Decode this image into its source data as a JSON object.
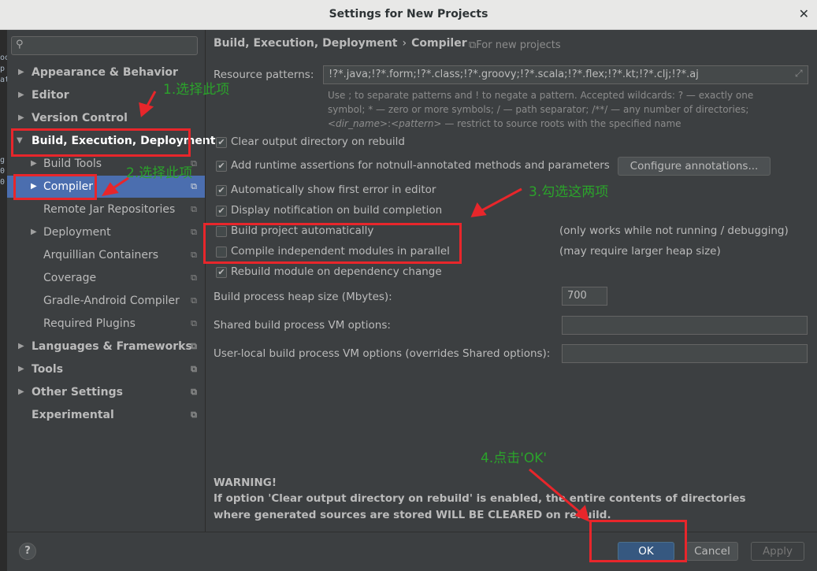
{
  "window": {
    "title": "Settings for New Projects"
  },
  "search": {
    "placeholder": ""
  },
  "tree": {
    "appearance": "Appearance & Behavior",
    "editor": "Editor",
    "version_control": "Version Control",
    "build": "Build, Execution, Deployment",
    "build_tools": "Build Tools",
    "compiler": "Compiler",
    "remote_jar": "Remote Jar Repositories",
    "deployment": "Deployment",
    "arquillian": "Arquillian Containers",
    "coverage": "Coverage",
    "gradle_android": "Gradle-Android Compiler",
    "required_plugins": "Required Plugins",
    "languages": "Languages & Frameworks",
    "tools": "Tools",
    "other_settings": "Other Settings",
    "experimental": "Experimental"
  },
  "breadcrumb": {
    "parent": "Build, Execution, Deployment",
    "separator": "›",
    "current": "Compiler",
    "scope": "⧉For new projects"
  },
  "compiler": {
    "resource_patterns_label": "Resource patterns:",
    "resource_patterns_value": "!?*.java;!?*.form;!?*.class;!?*.groovy;!?*.scala;!?*.flex;!?*.kt;!?*.clj;!?*.aj",
    "hint_line1": "Use ; to separate patterns and ! to negate a pattern. Accepted wildcards: ? — exactly one",
    "hint_line2": "symbol; * — zero or more symbols; / — path separator; /**/ — any number of directories;",
    "hint_line3_a": "<dir_name>",
    "hint_line3_b": ":",
    "hint_line3_c": "<pattern>",
    "hint_line3_d": " — restrict to source roots with the specified name",
    "clear_output": "Clear output directory on rebuild",
    "add_assertions": "Add runtime assertions for notnull-annotated methods and parameters",
    "configure_annotations": "Configure annotations...",
    "auto_show_error": "Automatically show first error in editor",
    "display_notification": "Display notification on build completion",
    "build_auto": "Build project automatically",
    "build_auto_note": "(only works while not running / debugging)",
    "compile_parallel": "Compile independent modules in parallel",
    "compile_parallel_note": "(may require larger heap size)",
    "rebuild_module": "Rebuild module on dependency change",
    "heap_label": "Build process heap size (Mbytes):",
    "heap_value": "700",
    "shared_vm_label": "Shared build process VM options:",
    "shared_vm_value": "",
    "user_vm_label": "User-local build process VM options (overrides Shared options):",
    "user_vm_value": "",
    "warning_title": "WARNING!",
    "warning_body": "If option 'Clear output directory on rebuild' is enabled, the entire contents of directories where generated sources are stored WILL BE CLEARED on rebuild."
  },
  "checkboxes": {
    "clear_output": true,
    "add_assertions": true,
    "auto_show_error": true,
    "display_notification": true,
    "build_auto": false,
    "compile_parallel": false,
    "rebuild_module": true
  },
  "buttons": {
    "help": "?",
    "ok": "OK",
    "cancel": "Cancel",
    "apply": "Apply"
  },
  "annotations": {
    "step1": "1.选择此项",
    "step2": "2.选择此项",
    "step3": "3.勾选这两项",
    "step4": "4.点击'OK'"
  },
  "colors": {
    "annotation_red": "#e8262b",
    "annotation_green": "#2ba32b",
    "selection": "#4b6eaf"
  }
}
